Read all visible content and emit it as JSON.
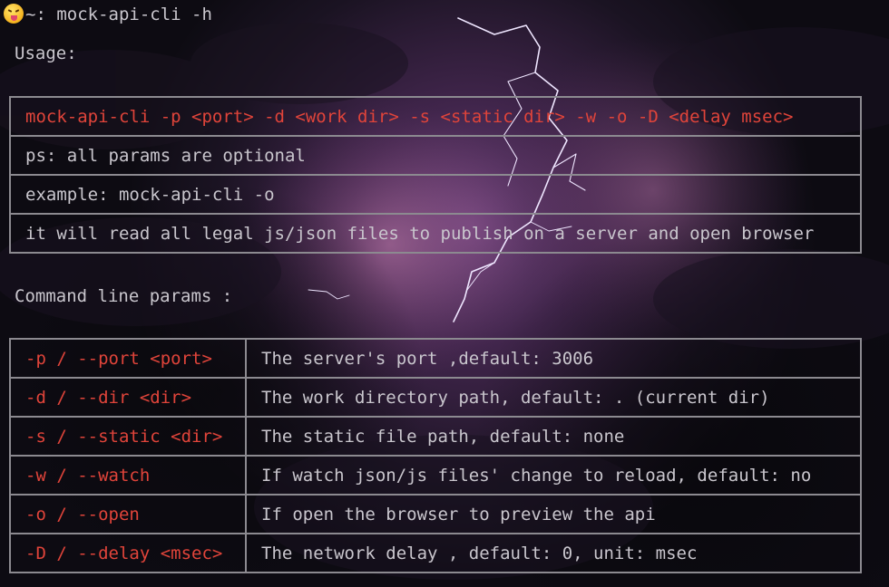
{
  "terminal": {
    "prompt_path": "~: ",
    "command": "mock-api-cli -h"
  },
  "usage": {
    "heading": "Usage:",
    "rows": [
      {
        "text": "mock-api-cli -p <port> -d <work dir> -s <static dir> -w -o -D <delay msec>",
        "color": "#e0443a"
      },
      {
        "text": "ps: all params are optional",
        "color": "#c9c6cd"
      },
      {
        "text": "example: mock-api-cli -o",
        "color": "#c9c6cd"
      },
      {
        "text": "it will read all legal js/json files to  publish on a server and open browser",
        "color": "#c9c6cd"
      }
    ]
  },
  "params": {
    "heading": "Command line params :",
    "rows": [
      {
        "flag": "-p / --port <port>",
        "desc": "The server's port ,default: 3006"
      },
      {
        "flag": "-d / --dir <dir>",
        "desc": "The work directory path, default: . (current dir)"
      },
      {
        "flag": "-s / --static <dir>",
        "desc": "The static file path, default: none"
      },
      {
        "flag": "-w / --watch",
        "desc": "If watch json/js files' change to reload, default: no"
      },
      {
        "flag": "-o / --open",
        "desc": "If open the browser to preview the api"
      },
      {
        "flag": "-D / --delay <msec>",
        "desc": "The network delay , default: 0, unit: msec"
      }
    ]
  },
  "colors": {
    "background": "#0d0b12",
    "text": "#c9c6cd",
    "accent_red": "#e0443a",
    "border": "#8c8a90"
  },
  "icons": {
    "prompt_emoji": "squinting-face-with-tongue-icon"
  }
}
